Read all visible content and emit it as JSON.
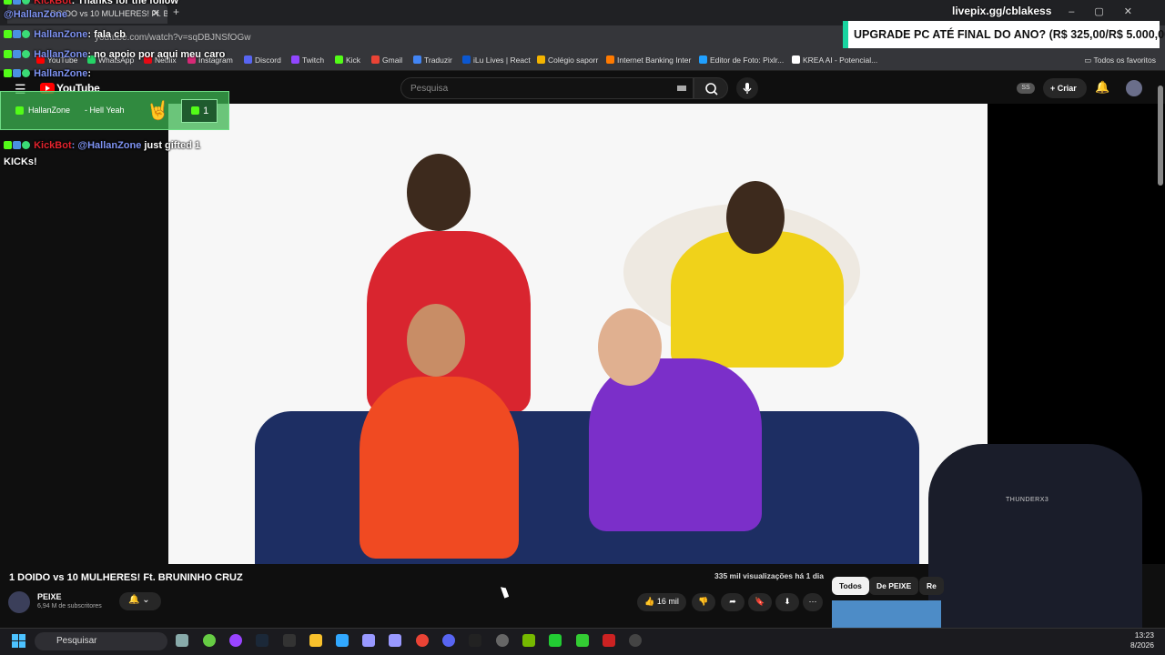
{
  "browser": {
    "tab_title": "1 DOIDO vs 10 MULHERES! Ft. B",
    "url": "youtube.com/watch?v=sqDBJNSfOGw",
    "bookmarks": [
      {
        "label": "YouTube",
        "color": "#ff0000"
      },
      {
        "label": "WhatsApp",
        "color": "#25d366"
      },
      {
        "label": "Netflix",
        "color": "#e50914"
      },
      {
        "label": "Instagram",
        "color": "#d62976"
      },
      {
        "label": "Discord",
        "color": "#5865f2"
      },
      {
        "label": "Twitch",
        "color": "#9146ff"
      },
      {
        "label": "Kick",
        "color": "#53fc18"
      },
      {
        "label": "Gmail",
        "color": "#ea4335"
      },
      {
        "label": "Traduzir",
        "color": "#4285f4"
      },
      {
        "label": "iLu Lives | React",
        "color": "#0b57d0"
      },
      {
        "label": "Colégio saporr",
        "color": "#f4b400"
      },
      {
        "label": "Internet Banking Inter",
        "color": "#ff7a00"
      },
      {
        "label": "Editor de Foto: Pixlr...",
        "color": "#20a0ff"
      },
      {
        "label": "KREA AI - Potencial...",
        "color": "#ffffff"
      }
    ],
    "favorites_label": "Todos os favoritos"
  },
  "overlay": {
    "livepix": "livepix.gg/cblakess",
    "banner": "UPGRADE PC ATÉ FINAL DO ANO? (R$ 325,00/R$ 5.000,00)",
    "chat": [
      {
        "user": "KickBot",
        "msg": ": Thanks for the follow",
        "bot": true
      },
      {
        "user": "@HallanZone",
        "msg": "",
        "bot": false
      },
      {
        "user": "HallanZone",
        "msg": ": fala cb",
        "bot": false
      },
      {
        "user": "HallanZone",
        "msg": ": no apoio por aqui meu caro",
        "bot": false
      },
      {
        "user": "HallanZone",
        "msg": ":",
        "bot": false
      }
    ],
    "gift": {
      "user": "HallanZone",
      "msg": "- Hell Yeah",
      "count": "1"
    },
    "kickbot_gift": {
      "user": "KickBot",
      "mention": ": @HallanZone",
      "msg": "just gifted 1",
      "line2": "KICKs!"
    },
    "chair_brand": "THUNDERX3"
  },
  "youtube": {
    "logo": "YouTube",
    "search_placeholder": "Pesquisa",
    "account_badge": "SS",
    "create_label": "+ Criar",
    "video_title": "1 DOIDO vs 10 MULHERES! Ft. BRUNINHO CRUZ",
    "views": "335 mil visualizações  há 1 dia",
    "channel_name": "PEIXE",
    "subscribers": "6,94 M de subscritores",
    "likes": "16 mil",
    "chips": [
      "Todos",
      "De PEIXE",
      "Re"
    ]
  },
  "taskbar": {
    "search_label": "Pesquisar",
    "time": "13:23",
    "date": "8/2026"
  }
}
